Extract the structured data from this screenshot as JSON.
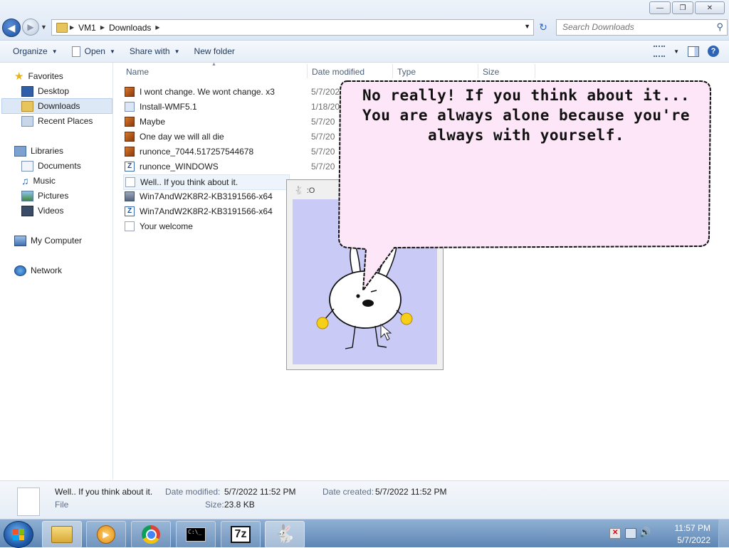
{
  "address": {
    "crumbs": [
      "VM1",
      "Downloads"
    ],
    "search_placeholder": "Search Downloads"
  },
  "window_buttons": [
    "minimize",
    "restore",
    "close"
  ],
  "toolbar": {
    "organize": "Organize",
    "open": "Open",
    "share_with": "Share with",
    "new_folder": "New folder"
  },
  "nav": {
    "favorites": "Favorites",
    "desktop": "Desktop",
    "downloads": "Downloads",
    "recent_places": "Recent Places",
    "libraries": "Libraries",
    "documents": "Documents",
    "music": "Music",
    "pictures": "Pictures",
    "videos": "Videos",
    "my_computer": "My Computer",
    "network": "Network"
  },
  "columns": {
    "name": "Name",
    "date_modified": "Date modified",
    "type": "Type",
    "size": "Size"
  },
  "files": [
    {
      "name": "I wont change. We wont change. x3",
      "date": "5/7/2022",
      "icon": "media-icon"
    },
    {
      "name": "Install-WMF5.1",
      "date": "1/18/20",
      "icon": "installer-icon"
    },
    {
      "name": "Maybe",
      "date": "5/7/20",
      "icon": "media-icon"
    },
    {
      "name": "One day we will all die",
      "date": "5/7/20",
      "icon": "media-icon"
    },
    {
      "name": "runonce_7044.517257544678",
      "date": "5/7/20",
      "icon": "media-icon"
    },
    {
      "name": "runonce_WINDOWS",
      "date": "5/7/20",
      "icon": "archive-icon"
    },
    {
      "name": "Well.. If you think about it.",
      "date": "",
      "icon": "document-icon"
    },
    {
      "name": "Win7AndW2K8R2-KB3191566-x64",
      "date": "",
      "icon": "image-icon"
    },
    {
      "name": "Win7AndW2K8R2-KB3191566-x64",
      "date": "",
      "icon": "archive-icon"
    },
    {
      "name": "Your welcome",
      "date": "",
      "icon": "document-icon"
    }
  ],
  "mascot_window": {
    "title": ":O"
  },
  "bubble": {
    "text": "No really! If you think about it... You are always alone because you're always with yourself."
  },
  "details": {
    "name": "Well.. If you think about it.",
    "type": "File",
    "date_modified_label": "Date modified:",
    "date_modified": "5/7/2022 11:52 PM",
    "date_created_label": "Date created:",
    "date_created": "5/7/2022 11:52 PM",
    "size_label": "Size:",
    "size": "23.8 KB"
  },
  "taskbar": {
    "start_tooltip": "Start",
    "apps": [
      "file-explorer-icon",
      "media-player-icon",
      "chrome-icon",
      "command-prompt-icon",
      "7zip-icon",
      "bunny-app-icon"
    ],
    "sevenzip_label": "7z",
    "time": "11:57 PM",
    "date": "5/7/2022"
  },
  "colors": {
    "bubble_fill": "#fde6f7",
    "mascot_bg": "#c9caf5",
    "accent": "#2d64b6"
  }
}
